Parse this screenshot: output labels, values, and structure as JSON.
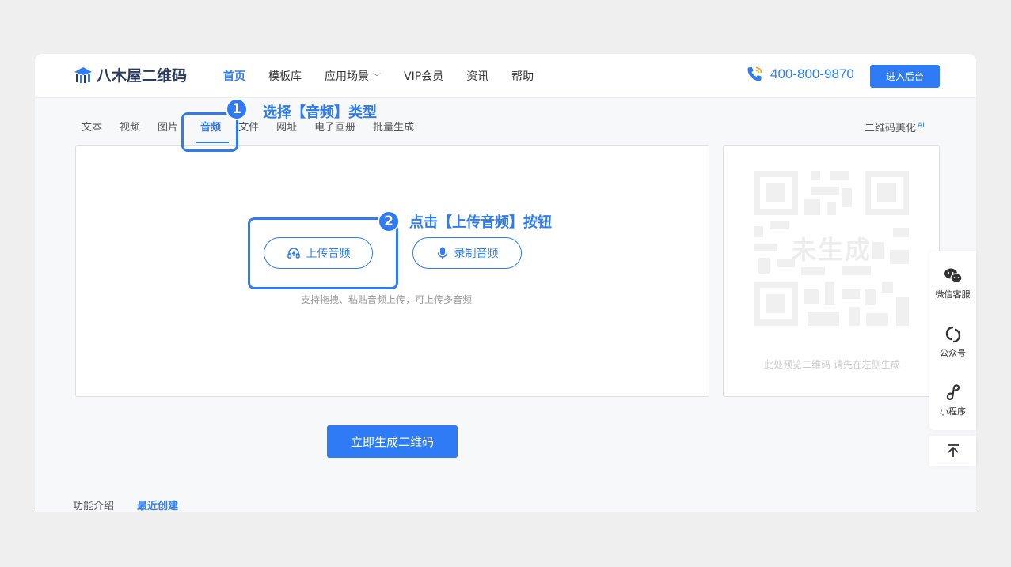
{
  "brand": {
    "name": "八木屋二维码",
    "accent": "#2f7bf5"
  },
  "nav": {
    "items": [
      {
        "label": "首页",
        "active": true
      },
      {
        "label": "模板库"
      },
      {
        "label": "应用场景",
        "dropdown": true
      },
      {
        "label": "VIP会员"
      },
      {
        "label": "资讯"
      },
      {
        "label": "帮助"
      }
    ]
  },
  "header": {
    "phone": "400-800-9870",
    "admin_label": "进入后台"
  },
  "type_tabs": {
    "items": [
      "文本",
      "视频",
      "图片",
      "音频",
      "文件",
      "网址",
      "电子画册",
      "批量生成"
    ],
    "active": "音频",
    "beautify_label": "二维码美化",
    "beautify_badge": "AI"
  },
  "annotations": {
    "step1_num": "1",
    "step1_text": "选择【音频】类型",
    "step2_num": "2",
    "step2_text": "点击【上传音频】按钮"
  },
  "editor": {
    "upload_label": "上传音频",
    "record_label": "录制音频",
    "hint": "支持拖拽、粘贴音频上传，可上传多音频"
  },
  "preview": {
    "overlay": "未生成",
    "hint": "此处预览二维码 请先在左侧生成"
  },
  "generate_label": "立即生成二维码",
  "bottom_tabs": {
    "items": [
      "功能介绍",
      "最近创建"
    ],
    "active": "最近创建"
  },
  "float_bar": {
    "items": [
      {
        "label": "微信客服",
        "icon": "wechat-icon"
      },
      {
        "label": "公众号",
        "icon": "official-account-icon"
      },
      {
        "label": "小程序",
        "icon": "mini-program-icon"
      }
    ],
    "top_icon": "back-to-top-icon"
  }
}
